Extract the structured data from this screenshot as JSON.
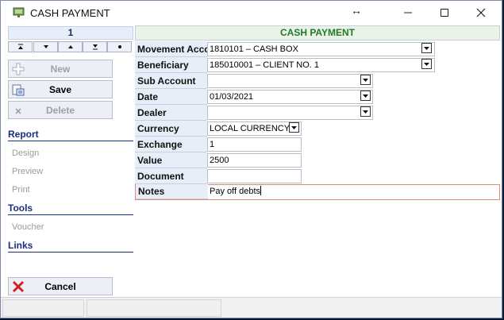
{
  "window": {
    "title": "CASH PAYMENT"
  },
  "sidebar": {
    "record_number": "1",
    "actions": {
      "new": "New",
      "save": "Save",
      "delete": "Delete",
      "cancel": "Cancel"
    },
    "report": {
      "heading": "Report",
      "items": [
        "Design",
        "Preview",
        "Print"
      ]
    },
    "tools": {
      "heading": "Tools",
      "items": [
        "Voucher"
      ]
    },
    "links": {
      "heading": "Links"
    }
  },
  "form": {
    "title": "CASH PAYMENT",
    "fields": {
      "movement_account": {
        "label": "Movement Account",
        "value": "1810101 – CASH BOX"
      },
      "beneficiary": {
        "label": "Beneficiary",
        "value": "185010001 – CLIENT NO. 1"
      },
      "sub_account": {
        "label": "Sub Account",
        "value": ""
      },
      "date": {
        "label": "Date",
        "value": "01/03/2021"
      },
      "dealer": {
        "label": "Dealer",
        "value": ""
      },
      "currency": {
        "label": "Currency",
        "value": "LOCAL CURRENCY"
      },
      "exchange": {
        "label": "Exchange",
        "value": "1"
      },
      "value": {
        "label": "Value",
        "value": "2500"
      },
      "document": {
        "label": "Document",
        "value": ""
      },
      "notes": {
        "label": "Notes",
        "value": "Pay off debts"
      }
    }
  }
}
